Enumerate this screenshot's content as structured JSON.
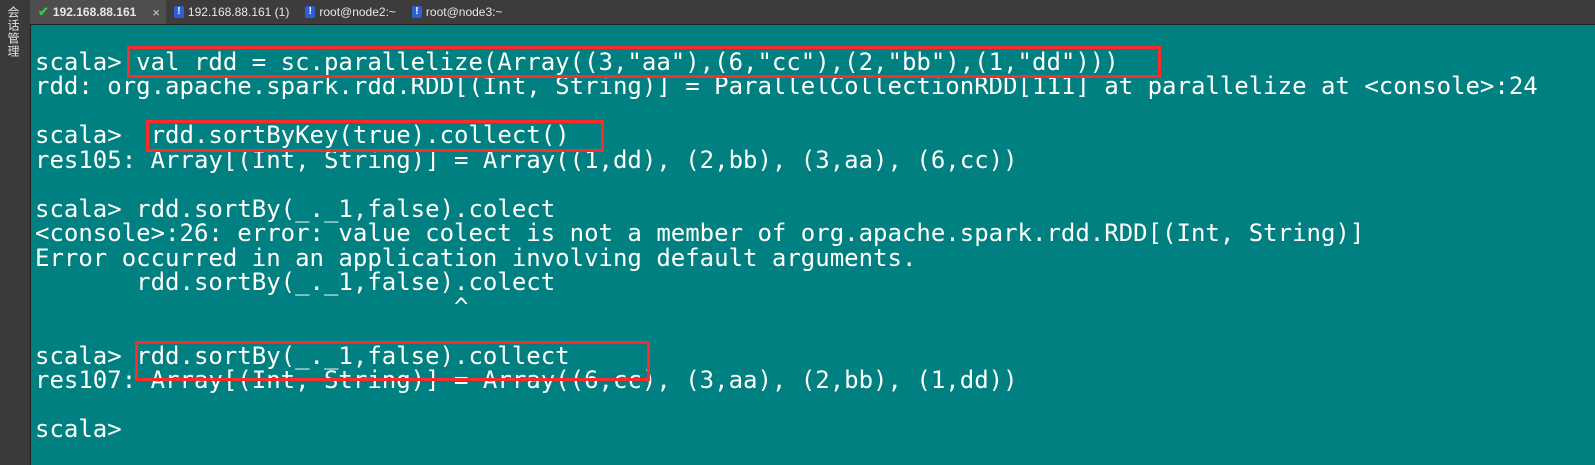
{
  "sidebar": {
    "label": "会话管理"
  },
  "tabs": [
    {
      "label": "192.168.88.161",
      "icon": "check-icon",
      "active": true,
      "close": "×"
    },
    {
      "label": "192.168.88.161 (1)",
      "icon": "warning-icon",
      "active": false
    },
    {
      "label": "root@node2:~",
      "icon": "warning-icon",
      "active": false
    },
    {
      "label": "root@node3:~",
      "icon": "warning-icon",
      "active": false
    }
  ],
  "terminal": {
    "background": "#008080",
    "highlight_color": "#ff2a2a",
    "lines": [
      "scala> val rdd = sc.parallelize(Array((3,\"aa\"),(6,\"cc\"),(2,\"bb\"),(1,\"dd\")))",
      "rdd: org.apache.spark.rdd.RDD[(Int, String)] = ParallelCollectionRDD[111] at parallelize at <console>:24",
      "",
      "scala>  rdd.sortByKey(true).collect()",
      "res105: Array[(Int, String)] = Array((1,dd), (2,bb), (3,aa), (6,cc))",
      "",
      "scala> rdd.sortBy(_._1,false).colect",
      "<console>:26: error: value colect is not a member of org.apache.spark.rdd.RDD[(Int, String)]",
      "Error occurred in an application involving default arguments.",
      "       rdd.sortBy(_._1,false).colect",
      "                             ^",
      "",
      "scala> rdd.sortBy(_._1,false).collect",
      "res107: Array[(Int, String)] = Array((6,cc), (3,aa), (2,bb), (1,dd))",
      "",
      "scala>"
    ]
  }
}
